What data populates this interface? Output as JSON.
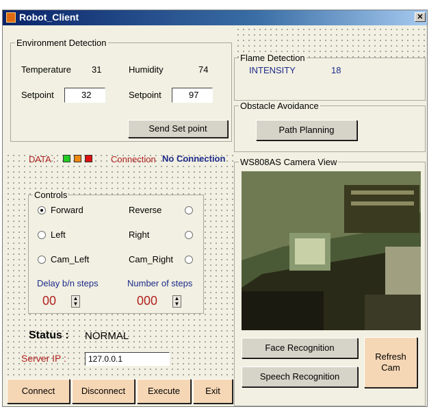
{
  "window": {
    "title": "Robot_Client",
    "close_glyph": "✕"
  },
  "environment": {
    "legend": "Environment Detection",
    "temperature_label": "Temperature",
    "temperature_value": "31",
    "humidity_label": "Humidity",
    "humidity_value": "74",
    "setpoint_label_1": "Setpoint",
    "setpoint_value_1": "32",
    "setpoint_label_2": "Setpoint",
    "setpoint_value_2": "97",
    "send_button": "Send Set point"
  },
  "flame": {
    "legend": "Flame Detection",
    "intensity_label": "INTENSITY",
    "intensity_value": "18"
  },
  "obstacle": {
    "legend": "Obstacle Avoidance",
    "path_button": "Path Planning"
  },
  "status_bar": {
    "data_label": "DATA :",
    "leds": [
      "#22cc22",
      "#ee8811",
      "#dd1111"
    ],
    "connection_label": "Connection",
    "connection_value": "No Connection"
  },
  "controls": {
    "legend": "Controls",
    "forward": "Forward",
    "reverse": "Reverse",
    "left": "Left",
    "right": "Right",
    "cam_left": "Cam_Left",
    "cam_right": "Cam_Right",
    "selected": "Forward",
    "delay_label": "Delay b/n steps",
    "delay_value": "00",
    "steps_label": "Number of steps",
    "steps_value": "000"
  },
  "status": {
    "label": "Status :",
    "value": "NORMAL"
  },
  "server": {
    "label": "Server IP :",
    "value": "127.0.0.1"
  },
  "camera": {
    "legend": "WS808AS Camera View",
    "face_button": "Face Recognition",
    "speech_button": "Speech Recognition",
    "refresh_button": "Refresh Cam"
  },
  "bottom_buttons": {
    "connect": "Connect",
    "disconnect": "Disconnect",
    "execute": "Execute",
    "exit": "Exit"
  }
}
